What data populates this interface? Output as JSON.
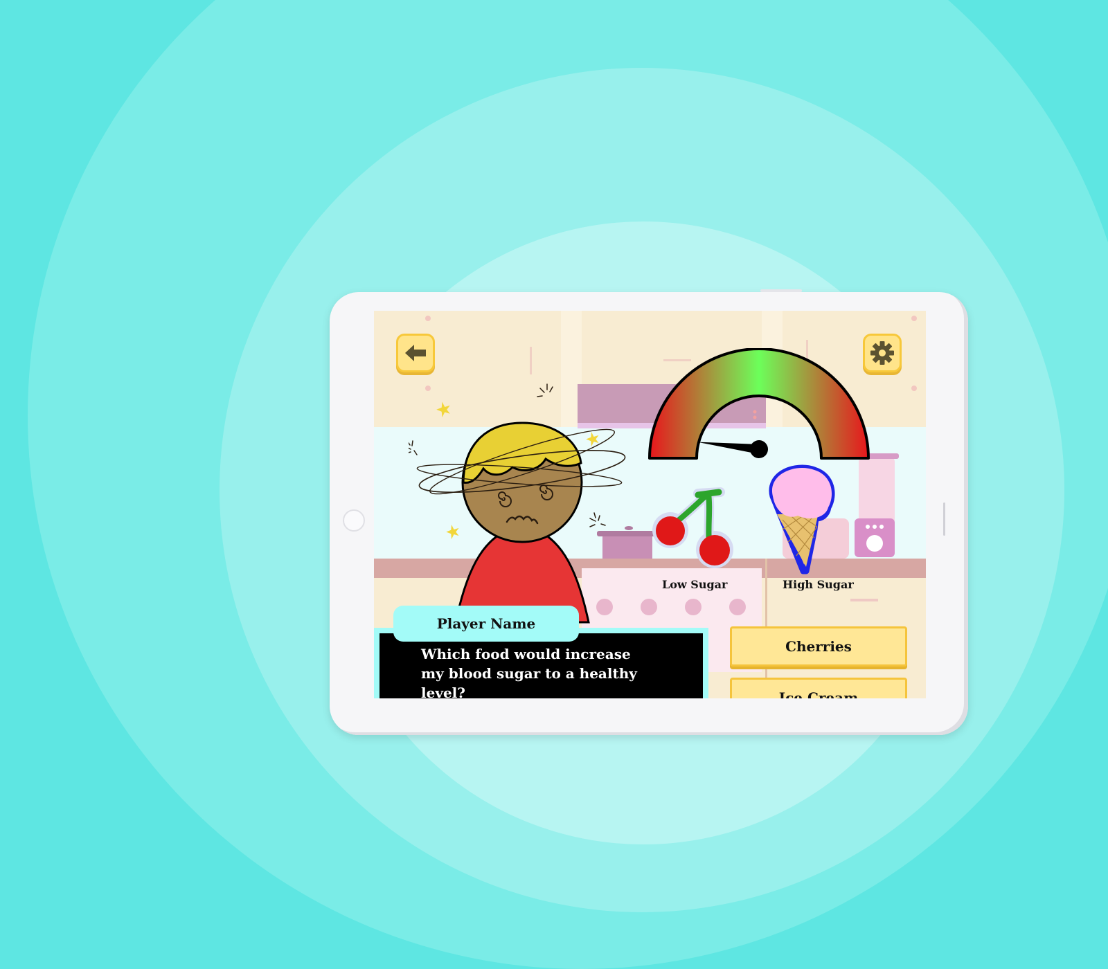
{
  "game": {
    "back_icon": "arrow-left-icon",
    "settings_icon": "gear-icon",
    "gauge": {
      "low_label": "Low Sugar",
      "high_label": "High Sugar",
      "needle_level": 0.03,
      "colors": {
        "low": "#e8161c",
        "mid": "#6cff5a",
        "high": "#e8161c"
      }
    },
    "food_items": [
      {
        "name": "cherries",
        "icon": "cherries-icon"
      },
      {
        "name": "ice cream",
        "icon": "ice-cream-icon"
      }
    ],
    "character_state": "dizzy",
    "player_name_label": "Player Name",
    "question": "Which food would increase my blood sugar to a healthy level?",
    "answers": [
      "Cherries",
      "Ice Cream"
    ]
  }
}
